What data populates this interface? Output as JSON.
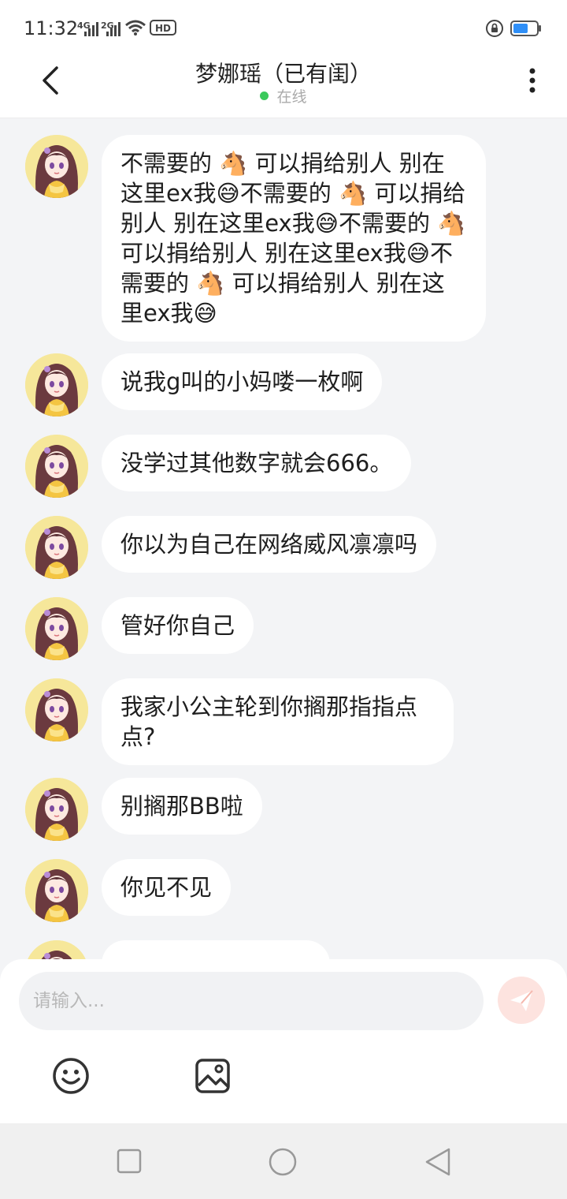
{
  "status_bar": {
    "time": "11:32",
    "signal_1_label": "4G",
    "signal_2_label": "2G",
    "hd_label": "HD",
    "battery_color": "#2f8ff7"
  },
  "header": {
    "title": "梦娜瑶（已有闺）",
    "online_text": "在线",
    "online_color": "#3bc95c"
  },
  "messages": [
    {
      "text": "不需要的 🐴 可以捐给别人 别在这里ex我😅不需要的 🐴 可以捐给别人 别在这里ex我😅不需要的 🐴 可以捐给别人 别在这里ex我😅不需要的 🐴 可以捐给别人 别在这里ex我😅"
    },
    {
      "text": "说我g叫的小妈喽一枚啊"
    },
    {
      "text": "没学过其他数字就会666。"
    },
    {
      "text": "你以为自己在网络威风凛凛吗"
    },
    {
      "text": "管好你自己"
    },
    {
      "text": "我家小公主轮到你搁那指指点点?"
    },
    {
      "text": "别搁那BB啦"
    },
    {
      "text": "你见不见"
    }
  ],
  "input": {
    "placeholder": "请输入...",
    "send_button_color": "#fde3df"
  },
  "icons": {
    "back": "chevron-left-icon",
    "more": "more-vertical-icon",
    "emoji": "smiley-icon",
    "image": "image-icon",
    "send": "paper-plane-icon"
  }
}
